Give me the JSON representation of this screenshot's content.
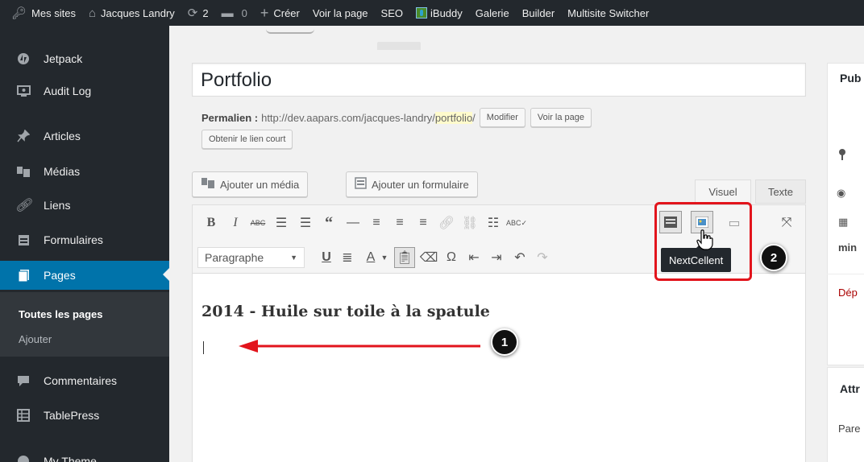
{
  "adminbar": {
    "mes_sites": "Mes sites",
    "site_name": "Jacques Landry",
    "updates_count": "2",
    "comments_count": "0",
    "create": "Créer",
    "view_page": "Voir la page",
    "seo": "SEO",
    "ibuddy": "iBuddy",
    "galerie": "Galerie",
    "builder": "Builder",
    "multisite": "Multisite Switcher"
  },
  "sidebar": {
    "items": [
      {
        "label": "Jetpack",
        "icon": "jetpack-icon"
      },
      {
        "label": "Audit Log",
        "icon": "monitor-icon"
      },
      {
        "label": "Articles",
        "icon": "pushpin-icon"
      },
      {
        "label": "Médias",
        "icon": "media-icon"
      },
      {
        "label": "Liens",
        "icon": "link-icon"
      },
      {
        "label": "Formulaires",
        "icon": "form-icon"
      },
      {
        "label": "Pages",
        "icon": "pages-icon"
      },
      {
        "label": "Commentaires",
        "icon": "comment-icon"
      },
      {
        "label": "TablePress",
        "icon": "table-icon"
      },
      {
        "label": "My Theme",
        "icon": "theme-icon"
      }
    ],
    "submenu": {
      "all_pages": "Toutes les pages",
      "add": "Ajouter"
    }
  },
  "editor": {
    "title": "Portfolio",
    "permalink_label": "Permalien :",
    "permalink_base": "http://dev.aapars.com/jacques-landry/",
    "permalink_slug": "portfolio",
    "permalink_end": "/",
    "btn_modify": "Modifier",
    "btn_view_page": "Voir la page",
    "btn_short_link": "Obtenir le lien court",
    "btn_add_media": "Ajouter un média",
    "btn_add_form": "Ajouter un formulaire",
    "tab_visual": "Visuel",
    "tab_text": "Texte",
    "format_select": "Paragraphe",
    "content_heading": "2014 - Huile sur toile à la spatule",
    "tooltip": "NextCellent"
  },
  "right_column": {
    "publish_title": "Pub",
    "publish_min": "min",
    "publish_delete": "Dép",
    "attributes_title": "Attr",
    "attributes_parent": "Pare"
  },
  "annotations": {
    "step1": "1",
    "step2": "2",
    "color": "#e2141c"
  },
  "colors": {
    "adminbar": "#23282d",
    "sidebar_current": "#0073aa",
    "accent_red": "#e2141c",
    "slug_highlight": "#fffbcc"
  }
}
